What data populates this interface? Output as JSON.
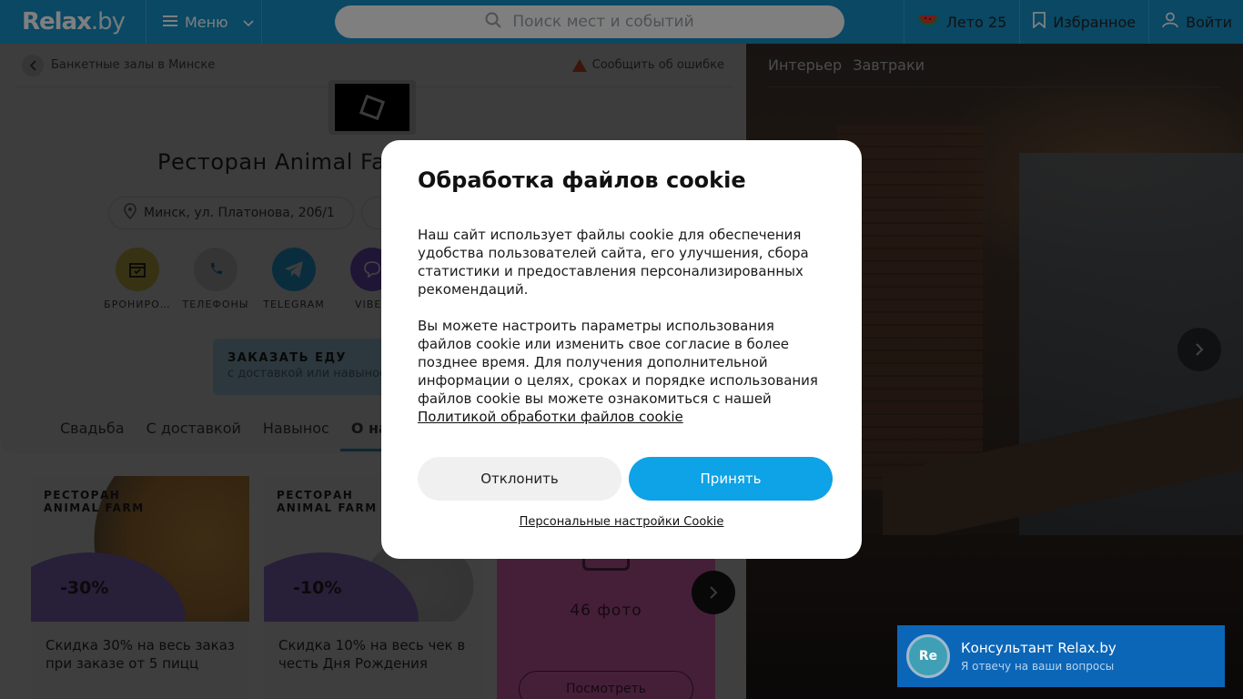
{
  "header": {
    "logo": "Relax",
    "logo_suffix": ".by",
    "menu_label": "Меню",
    "search_placeholder": "Поиск мест и событий",
    "summer_label": "Лето 25",
    "favorites_label": "Избранное",
    "login_label": "Войти"
  },
  "breadcrumb": {
    "label": "Банкетные залы в Минске",
    "report_label": "Сообщить об ошибке"
  },
  "venue": {
    "title": "Ресторан Animal Farm",
    "address": "Минск, ул. Платонова, 20б/1"
  },
  "actions": [
    {
      "label": "БРОНИРО…",
      "color": "#6c6526"
    },
    {
      "label": "ТЕЛЕФОНЫ",
      "color": "#6b6b6b"
    },
    {
      "label": "TELEGRAM",
      "color": "#155a7c"
    },
    {
      "label": "VIBER",
      "color": "#3f2d6c"
    }
  ],
  "order_food": {
    "title": "ЗАКАЗАТЬ ЕДУ",
    "subtitle": "с доставкой или навынос"
  },
  "tabs": [
    "Свадьба",
    "С доставкой",
    "Навынос",
    "О нас"
  ],
  "offers": [
    {
      "brand_line1": "РЕСТОРАН",
      "brand_line2": "ANIMAL FARM",
      "discount": "-30%",
      "text": "Скидка 30% на весь заказ при заказе от 5 пицц"
    },
    {
      "brand_line1": "РЕСТОРАН",
      "brand_line2": "ANIMAL FARM",
      "discount": "-10%",
      "text": "Скидка 10% на весь чек в честь Дня Рождения"
    }
  ],
  "photos_card": {
    "count": "46 фото",
    "button": "Посмотреть"
  },
  "photo_tabs": [
    "Интерьер",
    "Завтраки"
  ],
  "cookie_modal": {
    "title": "Обработка файлов cookie",
    "para1": "Наш сайт использует файлы cookie для обеспечения удобства пользователей сайта, его улучшения, сбора статистики и предоставления персонализированных рекомендаций.",
    "para2": "Вы можете настроить параметры использования файлов cookie или изменить свое согласие в более позднее время. Для получения дополнительной информации о целях, сроках и порядке использования файлов cookie вы можете ознакомиться с нашей",
    "policy_link": "Политикой обработки файлов cookie",
    "decline": "Отклонить",
    "accept": "Принять",
    "personal_settings": "Персональные настройки Cookie"
  },
  "consultant": {
    "avatar": "Re",
    "name": "Консультант Relax.by",
    "subtitle": "Я отвечу на ваши вопросы"
  },
  "colors": {
    "header_bg": "#1591c9",
    "accept_bg": "#0ea2e6",
    "consultant_bg": "#0b66b8"
  }
}
